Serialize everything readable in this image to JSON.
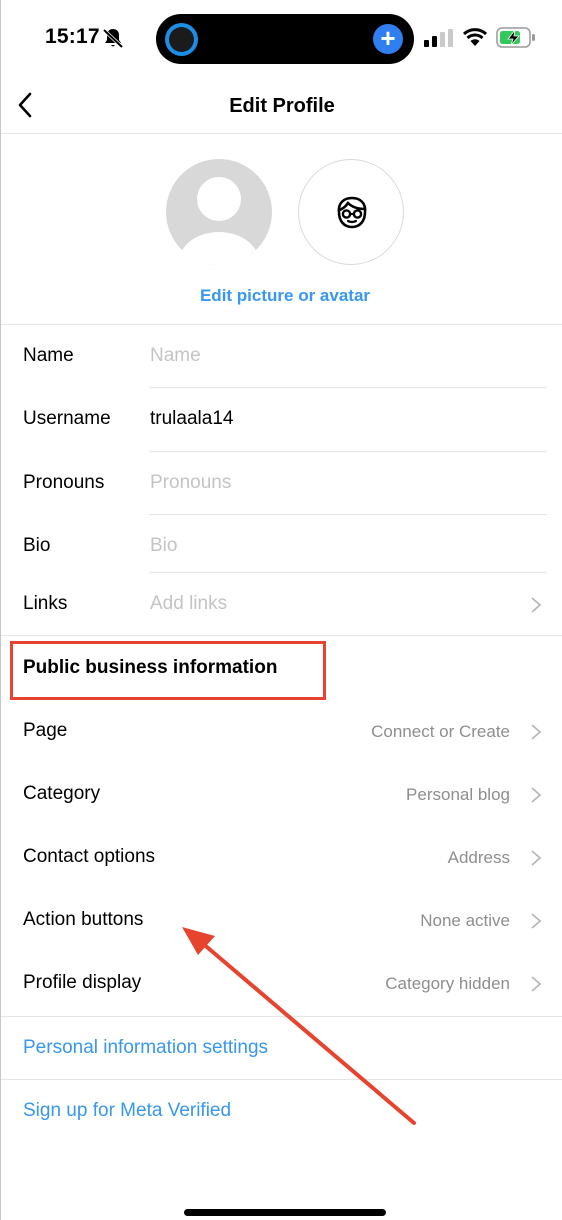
{
  "status_bar": {
    "time": "15:17"
  },
  "nav": {
    "title": "Edit Profile"
  },
  "avatar": {
    "edit_label": "Edit picture or avatar"
  },
  "profile_fields": [
    {
      "label": "Name",
      "value": "",
      "placeholder": "Name"
    },
    {
      "label": "Username",
      "value": "trulaala14",
      "placeholder": ""
    },
    {
      "label": "Pronouns",
      "value": "",
      "placeholder": "Pronouns"
    },
    {
      "label": "Bio",
      "value": "",
      "placeholder": "Bio"
    },
    {
      "label": "Links",
      "value": "",
      "placeholder": "Add links"
    }
  ],
  "business": {
    "section_title": "Public business information",
    "rows": [
      {
        "label": "Page",
        "value": "Connect or Create"
      },
      {
        "label": "Category",
        "value": "Personal blog"
      },
      {
        "label": "Contact options",
        "value": "Address"
      },
      {
        "label": "Action buttons",
        "value": "None active"
      },
      {
        "label": "Profile display",
        "value": "Category hidden"
      }
    ]
  },
  "links": {
    "personal_info": "Personal information settings",
    "meta_verified": "Sign up for Meta Verified"
  },
  "colors": {
    "accent_blue": "#3897f0",
    "annotation_red": "#e6442e",
    "placeholder_gray": "#c4c4c4",
    "value_gray": "#8e8e8e"
  },
  "icons": [
    "bell-muted-icon",
    "cellular-signal-icon",
    "wifi-icon",
    "battery-charging-icon",
    "back-chevron-icon",
    "default-avatar-icon",
    "avatar-face-icon",
    "chevron-right-icon"
  ]
}
